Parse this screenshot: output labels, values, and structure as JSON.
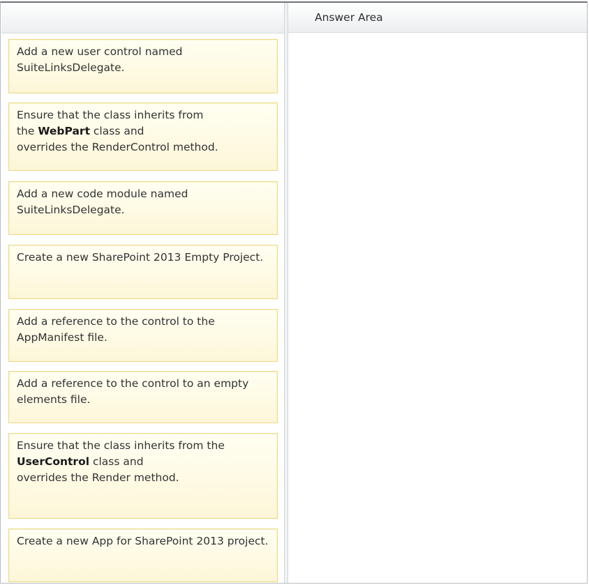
{
  "answer_area": {
    "title": "Answer Area"
  },
  "cards": [
    {
      "text": "Add a new user control named SuiteLinksDelegate."
    },
    {
      "line1": "Ensure that the class inherits from",
      "line2_pre": "the ",
      "line2_bold": "WebPart",
      "line2_post": " class and",
      "line3": "overrides the RenderControl method."
    },
    {
      "text": "Add a new code module named SuiteLinksDelegate."
    },
    {
      "text": "Create a new SharePoint 2013 Empty Project."
    },
    {
      "text": "Add a reference to the control to the AppManifest file."
    },
    {
      "text": "Add a reference to the control to an empty elements file."
    },
    {
      "line1": "Ensure that the class inherits from the",
      "line2_bold": "UserControl",
      "line2_post": " class and",
      "line3": "overrides the Render method."
    },
    {
      "text": "Create a new App for SharePoint 2013 project."
    }
  ]
}
